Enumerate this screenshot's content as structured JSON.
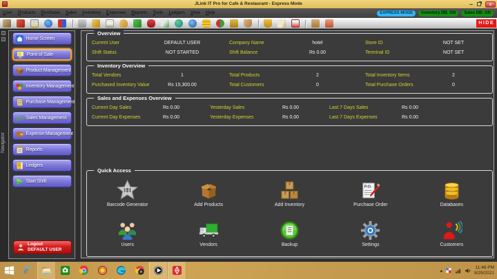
{
  "window": {
    "title": "JLink IT Pro for Cafe & Restaurant - Express Mode",
    "close_glyph": "x",
    "minimize_glyph": "–"
  },
  "menu": {
    "items": [
      "User",
      "Products",
      "Purchase",
      "Sales",
      "Inventory",
      "Expenses",
      "Reports",
      "Tools",
      "Ledgers",
      "View",
      "Help"
    ],
    "badges": [
      {
        "label": "EXPRESS MODE",
        "cls": "blue"
      },
      {
        "label": "Inventory DB: ON",
        "cls": "green"
      },
      {
        "label": "Sales DB: ON",
        "cls": "green"
      }
    ]
  },
  "toolbar": {
    "hide_label": "HIDE",
    "icons": [
      {
        "name": "exit-icon",
        "cls": "t01"
      },
      {
        "name": "logout-door-icon",
        "cls": "t02"
      },
      {
        "name": "pos-terminal-icon",
        "cls": "t03"
      },
      {
        "name": "home-icon",
        "cls": "t04"
      },
      {
        "name": "sync-icon",
        "cls": "t05",
        "sep_after": true
      },
      {
        "name": "user-icon",
        "cls": "t06"
      },
      {
        "name": "security-key-icon",
        "cls": "t07"
      },
      {
        "name": "calendar-icon",
        "cls": "t08"
      },
      {
        "name": "users-group-icon",
        "cls": "t09"
      },
      {
        "name": "purchase-cart-icon",
        "cls": "t10"
      },
      {
        "name": "expense-icon",
        "cls": "t11"
      },
      {
        "name": "sales-chart-icon",
        "cls": "t12"
      },
      {
        "name": "globe-green-icon",
        "cls": "t13"
      },
      {
        "name": "globe-blue-icon",
        "cls": "t14"
      },
      {
        "name": "coins-icon",
        "cls": "t15"
      },
      {
        "name": "products-icon",
        "cls": "t16"
      },
      {
        "name": "sitemap-icon",
        "cls": "t17"
      },
      {
        "name": "basket-icon",
        "cls": "t18",
        "sep_after": true
      },
      {
        "name": "bag-icon",
        "cls": "t19"
      },
      {
        "name": "receipt-icon",
        "cls": "t20"
      },
      {
        "name": "media-icon",
        "cls": "t21",
        "sep_after": true
      },
      {
        "name": "package-icon",
        "cls": "t22"
      },
      {
        "name": "delivery-icon",
        "cls": "t23"
      }
    ]
  },
  "navigator": {
    "label": "Navigator"
  },
  "sidebar": {
    "items": [
      {
        "label": "Home Screen",
        "icon": "#sb-home",
        "active": false
      },
      {
        "label": "Point of Sale",
        "icon": "#sb-pos",
        "active": true
      },
      {
        "label": "Product Management",
        "icon": "#sb-product",
        "active": false
      },
      {
        "label": "Inventory Management",
        "icon": "#sb-inventory",
        "active": false
      },
      {
        "label": "Purchase Management",
        "icon": "#sb-purchase",
        "active": false
      },
      {
        "label": "Sales Management",
        "icon": "#sb-sales",
        "active": false
      },
      {
        "label": "Expense Management",
        "icon": "#sb-expense",
        "active": false
      },
      {
        "label": "Reports",
        "icon": "#sb-reports",
        "active": false
      },
      {
        "label": "Ledgers",
        "icon": "#sb-ledgers",
        "active": false
      },
      {
        "label": "Start Shift",
        "icon": "#sb-start",
        "active": false
      }
    ],
    "logout": {
      "line1": "Logout",
      "line2": "DEFAULT USER"
    }
  },
  "overview": {
    "title": "Overview",
    "rows": [
      [
        {
          "label": "Current User",
          "value": "DEFAULT USER"
        },
        {
          "label": "Company Name",
          "value": "hotel"
        },
        {
          "label": "Store ID",
          "value": "NOT SET"
        }
      ],
      [
        {
          "label": "Shift Status",
          "value": "NOT STARTED"
        },
        {
          "label": "Shift Balance",
          "value": "Rs 0.00"
        },
        {
          "label": "Terminal ID",
          "value": "NOT SET"
        }
      ]
    ]
  },
  "inventory_overview": {
    "title": "Inventory Overview",
    "rows": [
      [
        {
          "label": "Total Vendors",
          "value": "1"
        },
        {
          "label": "Total Products",
          "value": "2"
        },
        {
          "label": "Total Inventory Items",
          "value": "2"
        }
      ],
      [
        {
          "label": "Purchased Inventory Value",
          "value": "Rs 15,300.00"
        },
        {
          "label": "Total Customers",
          "value": "0"
        },
        {
          "label": "Total Purchase Orders",
          "value": "0"
        }
      ]
    ]
  },
  "sales_expenses_overview": {
    "title": "Sales and Expenses Overview",
    "rows": [
      [
        {
          "label": "Current Day Sales",
          "value": "Rs 0.00"
        },
        {
          "label": "Yesterday Sales",
          "value": "Rs 0.00"
        },
        {
          "label": "Last 7 Days Sales",
          "value": "Rs 0.00"
        }
      ],
      [
        {
          "label": "Current Day Expenses",
          "value": "Rs 0.00"
        },
        {
          "label": "Yesterday Expenses",
          "value": "Rs 0.00"
        },
        {
          "label": "Last 7 Days Expenses",
          "value": "Rs 0.00"
        }
      ]
    ]
  },
  "quick_access": {
    "title": "Quick Access",
    "items": [
      {
        "label": "Barcode Generator",
        "icon": "#qa-barcode"
      },
      {
        "label": "Add Products",
        "icon": "#qa-box"
      },
      {
        "label": "Add Inventory",
        "icon": "#qa-stack"
      },
      {
        "label": "Purchase Order",
        "icon": "#qa-po"
      },
      {
        "label": "Databases",
        "icon": "#qa-db"
      },
      {
        "label": "Users",
        "icon": "#qa-users"
      },
      {
        "label": "Vendors",
        "icon": "#qa-truck"
      },
      {
        "label": "Backup",
        "icon": "#qa-backup"
      },
      {
        "label": "Settings",
        "icon": "#qa-settings"
      },
      {
        "label": "Customers",
        "icon": "#qa-customers"
      }
    ]
  },
  "taskbar": {
    "icons": [
      {
        "name": "start-button-icon",
        "icon": "#tk-win",
        "tile": false
      },
      {
        "name": "internet-explorer-icon",
        "icon": "#tk-ie",
        "tile": false
      },
      {
        "name": "file-explorer-icon",
        "icon": "#tk-folder",
        "tile": true
      },
      {
        "name": "green-app-icon",
        "icon": "#tk-greenapp",
        "tile": false
      },
      {
        "name": "chrome-icon",
        "icon": "#tk-chrome",
        "tile": false
      },
      {
        "name": "firefox-icon",
        "icon": "#tk-firefox",
        "tile": false
      },
      {
        "name": "edge-icon",
        "icon": "#tk-edge",
        "tile": false
      },
      {
        "name": "chrome-profile-icon",
        "icon": "#tk-chromedark",
        "tile": false
      },
      {
        "name": "media-player-icon",
        "icon": "#tk-media",
        "tile": true
      },
      {
        "name": "red-app-icon",
        "icon": "#tk-redapp",
        "tile": true
      }
    ],
    "tray": {
      "time": "11:46 PM",
      "date": "8/29/2021"
    }
  }
}
